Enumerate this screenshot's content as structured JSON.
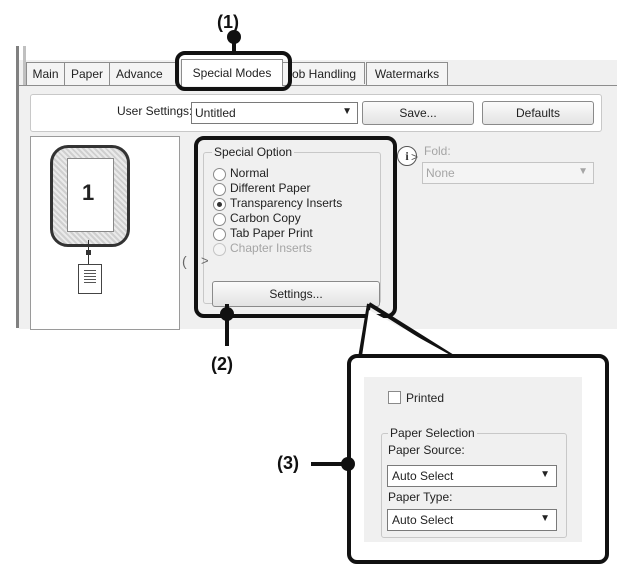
{
  "callouts": {
    "c1": "(1)",
    "c2": "(2)",
    "c3": "(3)"
  },
  "tabs": [
    "Main",
    "Paper",
    "Advance",
    "Special Modes",
    "ob Handling",
    "Watermarks"
  ],
  "user_settings": {
    "label": "User Settings:",
    "value": "Untitled",
    "save_label": "Save...",
    "defaults_label": "Defaults"
  },
  "preview": {
    "page_number": "1"
  },
  "special_option": {
    "group_label": "Special Option",
    "options": [
      {
        "label": "Normal",
        "checked": false,
        "disabled": false
      },
      {
        "label": "Different Paper",
        "checked": false,
        "disabled": false
      },
      {
        "label": "Transparency Inserts",
        "checked": true,
        "disabled": false
      },
      {
        "label": "Carbon Copy",
        "checked": false,
        "disabled": false
      },
      {
        "label": "Tab Paper Print",
        "checked": false,
        "disabled": false
      },
      {
        "label": "Chapter Inserts",
        "checked": false,
        "disabled": true
      }
    ],
    "settings_label": "Settings..."
  },
  "fold": {
    "label": "Fold:",
    "value": "None"
  },
  "transparency_settings": {
    "printed_label": "Printed",
    "printed_checked": false,
    "group_label": "Paper Selection",
    "source_label": "Paper Source:",
    "source_value": "Auto Select",
    "type_label": "Paper Type:",
    "type_value": "Auto Select"
  },
  "colors": {
    "outline": "#111111",
    "dialog_bg": "#f0f0f0",
    "disabled_text": "#a5a5a5"
  }
}
